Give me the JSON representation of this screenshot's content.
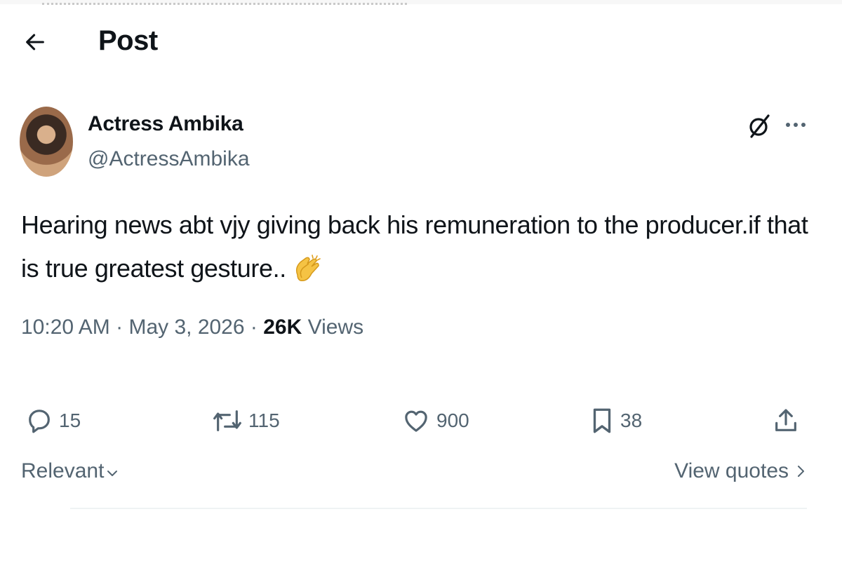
{
  "header": {
    "back_icon": "arrow-left-icon",
    "title": "Post"
  },
  "post": {
    "author": {
      "name": "Actress Ambika",
      "handle": "@ActressAmbika"
    },
    "text_line1": "Hearing news abt vjy giving back his remuneration to the producer.if that",
    "text_line2": "is true greatest gesture..",
    "emoji": "clapping-hands",
    "time": "10:20 AM",
    "separator": "·",
    "date": "May 3, 2026",
    "views_count": "26K",
    "views_label": "Views"
  },
  "actions": {
    "replies": "15",
    "reposts": "115",
    "likes": "900",
    "bookmarks": "38"
  },
  "footer": {
    "sort_label": "Relevant",
    "view_quotes_label": "View quotes"
  },
  "colors": {
    "text": "#0f1419",
    "secondary": "#536471",
    "divider": "#eff3f4"
  }
}
